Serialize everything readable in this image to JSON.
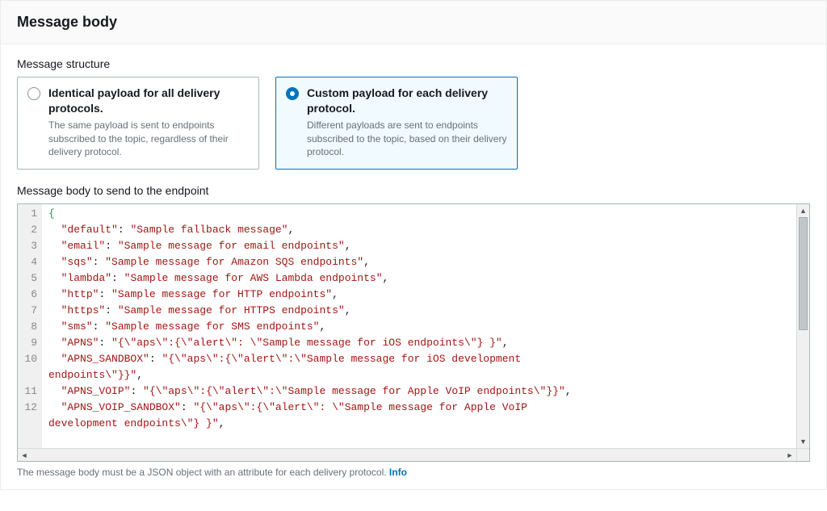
{
  "header": {
    "title": "Message body"
  },
  "structure": {
    "label": "Message structure",
    "options": [
      {
        "id": "identical",
        "title": "Identical payload for all delivery protocols.",
        "desc": "The same payload is sent to endpoints subscribed to the topic, regardless of their delivery protocol.",
        "selected": false
      },
      {
        "id": "custom",
        "title": "Custom payload for each delivery protocol.",
        "desc": "Different payloads are sent to endpoints subscribed to the topic, based on their delivery protocol.",
        "selected": true
      }
    ]
  },
  "editor": {
    "label": "Message body to send to the endpoint",
    "code_json": {
      "default": "Sample fallback message",
      "email": "Sample message for email endpoints",
      "sqs": "Sample message for Amazon SQS endpoints",
      "lambda": "Sample message for AWS Lambda endpoints",
      "http": "Sample message for HTTP endpoints",
      "https": "Sample message for HTTPS endpoints",
      "sms": "Sample message for SMS endpoints",
      "APNS": "{\"aps\":{\"alert\": \"Sample message for iOS endpoints\"} }",
      "APNS_SANDBOX": "{\"aps\":{\"alert\":\"Sample message for iOS development endpoints\"}}",
      "APNS_VOIP": "{\"aps\":{\"alert\":\"Sample message for Apple VoIP endpoints\"}}",
      "APNS_VOIP_SANDBOX": "{\"aps\":{\"alert\": \"Sample message for Apple VoIP development endpoints\"} }"
    }
  },
  "helper": {
    "text": "The message body must be a JSON object with an attribute for each delivery protocol. ",
    "link": "Info"
  }
}
